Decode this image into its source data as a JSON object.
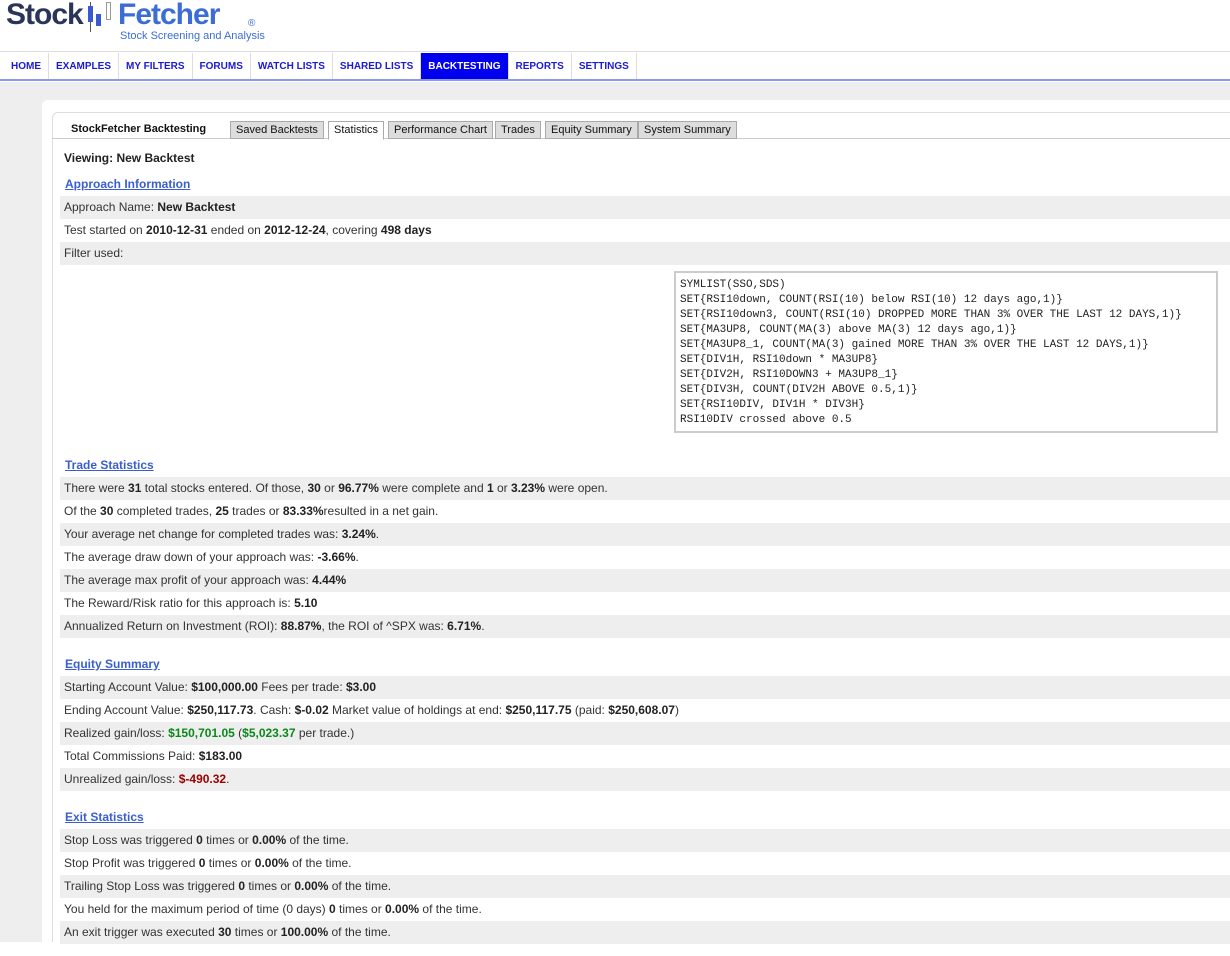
{
  "logo": {
    "word1": "Stock",
    "word2": "Fetcher",
    "tagline": "Stock Screening and Analysis"
  },
  "nav": [
    "HOME",
    "EXAMPLES",
    "MY FILTERS",
    "FORUMS",
    "WATCH LISTS",
    "SHARED LISTS",
    "BACKTESTING",
    "REPORTS",
    "SETTINGS"
  ],
  "nav_active": "BACKTESTING",
  "tabs": {
    "title": "StockFetcher Backtesting",
    "items": [
      "Saved Backtests",
      "Statistics",
      "Performance Chart",
      "Trades",
      "Equity Summary",
      "System Summary"
    ],
    "active": "Statistics"
  },
  "viewing": "Viewing: New Backtest",
  "sections": [
    {
      "title": "Approach Information",
      "rows": [
        [
          {
            "t": "Approach Name: "
          },
          {
            "t": "New Backtest",
            "b": 1
          }
        ],
        [
          {
            "t": "Test started on "
          },
          {
            "t": "2010-12-31",
            "b": 1
          },
          {
            "t": " ended on "
          },
          {
            "t": "2012-12-24",
            "b": 1
          },
          {
            "t": ", covering "
          },
          {
            "t": "498 days",
            "b": 1
          }
        ],
        [
          {
            "t": "Filter used:"
          }
        ]
      ]
    },
    {
      "title": "Trade Statistics",
      "rows": [
        [
          {
            "t": "There were "
          },
          {
            "t": "31",
            "b": 1
          },
          {
            "t": " total stocks entered. Of those, "
          },
          {
            "t": "30",
            "b": 1
          },
          {
            "t": " or "
          },
          {
            "t": "96.77%",
            "b": 1
          },
          {
            "t": " were complete and "
          },
          {
            "t": "1",
            "b": 1
          },
          {
            "t": " or "
          },
          {
            "t": "3.23%",
            "b": 1
          },
          {
            "t": " were open."
          }
        ],
        [
          {
            "t": "Of the "
          },
          {
            "t": "30",
            "b": 1
          },
          {
            "t": " completed trades, "
          },
          {
            "t": "25",
            "b": 1
          },
          {
            "t": " trades or "
          },
          {
            "t": "83.33%",
            "b": 1
          },
          {
            "t": "resulted in a net gain."
          }
        ],
        [
          {
            "t": "Your average net change for completed trades was: "
          },
          {
            "t": "3.24%",
            "b": 1
          },
          {
            "t": "."
          }
        ],
        [
          {
            "t": "The average draw down of your approach was: "
          },
          {
            "t": "-3.66%",
            "b": 1
          },
          {
            "t": "."
          }
        ],
        [
          {
            "t": "The average max profit of your approach was: "
          },
          {
            "t": "4.44%",
            "b": 1
          }
        ],
        [
          {
            "t": "The Reward/Risk ratio for this approach is: "
          },
          {
            "t": "5.10",
            "b": 1
          }
        ],
        [
          {
            "t": "Annualized Return on Investment (ROI): "
          },
          {
            "t": "88.87%",
            "b": 1
          },
          {
            "t": ", the ROI of ^SPX was: "
          },
          {
            "t": "6.71%",
            "b": 1
          },
          {
            "t": "."
          }
        ]
      ]
    },
    {
      "title": "Equity Summary",
      "rows": [
        [
          {
            "t": "Starting Account Value: "
          },
          {
            "t": "$100,000.00",
            "b": 1
          },
          {
            "t": " Fees per trade: "
          },
          {
            "t": "$3.00",
            "b": 1
          }
        ],
        [
          {
            "t": "Ending Account Value: "
          },
          {
            "t": "$250,117.73",
            "b": 1
          },
          {
            "t": ". Cash: "
          },
          {
            "t": "$-0.02",
            "b": 1
          },
          {
            "t": " Market value of holdings at end: "
          },
          {
            "t": "$250,117.75",
            "b": 1
          },
          {
            "t": " (paid: "
          },
          {
            "t": "$250,608.07",
            "b": 1
          },
          {
            "t": ")"
          }
        ],
        [
          {
            "t": "Realized gain/loss: "
          },
          {
            "t": "$150,701.05",
            "b": 1,
            "c": "g"
          },
          {
            "t": " ("
          },
          {
            "t": "$5,023.37",
            "b": 1,
            "c": "g"
          },
          {
            "t": " per trade.)"
          }
        ],
        [
          {
            "t": "Total Commissions Paid: "
          },
          {
            "t": "$183.00",
            "b": 1
          }
        ],
        [
          {
            "t": "Unrealized gain/loss: "
          },
          {
            "t": "$-490.32",
            "b": 1,
            "c": "r"
          },
          {
            "t": "."
          }
        ]
      ]
    },
    {
      "title": "Exit Statistics",
      "rows": [
        [
          {
            "t": "Stop Loss was triggered "
          },
          {
            "t": "0",
            "b": 1
          },
          {
            "t": " times or "
          },
          {
            "t": "0.00%",
            "b": 1
          },
          {
            "t": " of the time."
          }
        ],
        [
          {
            "t": "Stop Profit was triggered "
          },
          {
            "t": "0",
            "b": 1
          },
          {
            "t": " times or "
          },
          {
            "t": "0.00%",
            "b": 1
          },
          {
            "t": " of the time."
          }
        ],
        [
          {
            "t": "Trailing Stop Loss was triggered "
          },
          {
            "t": "0",
            "b": 1
          },
          {
            "t": " times or "
          },
          {
            "t": "0.00%",
            "b": 1
          },
          {
            "t": " of the time."
          }
        ],
        [
          {
            "t": "You held for the maximum period of time (0 days) "
          },
          {
            "t": "0",
            "b": 1
          },
          {
            "t": " times or "
          },
          {
            "t": "0.00%",
            "b": 1
          },
          {
            "t": " of the time."
          }
        ],
        [
          {
            "t": "An exit trigger was executed "
          },
          {
            "t": "30",
            "b": 1
          },
          {
            "t": " times or "
          },
          {
            "t": "100.00%",
            "b": 1
          },
          {
            "t": " of the time."
          }
        ]
      ]
    }
  ],
  "filter_text": "SYMLIST(SSO,SDS)\nSET{RSI10down, COUNT(RSI(10) below RSI(10) 12 days ago,1)}\nSET{RSI10down3, COUNT(RSI(10) DROPPED MORE THAN 3% OVER THE LAST 12 DAYS,1)}\nSET{MA3UP8, COUNT(MA(3) above MA(3) 12 days ago,1)}\nSET{MA3UP8_1, COUNT(MA(3) gained MORE THAN 3% OVER THE LAST 12 DAYS,1)}\nSET{DIV1H, RSI10down * MA3UP8}\nSET{DIV2H, RSI10DOWN3 + MA3UP8_1}\nSET{DIV3H, COUNT(DIV2H ABOVE 0.5,1)}\nSET{RSI10DIV, DIV1H * DIV3H}\nRSI10DIV crossed above 0.5",
  "colors": {
    "nav_active": "#0000ee",
    "link": "#3a5ed0",
    "gain": "#0a8a1a",
    "loss": "#9a0000"
  }
}
